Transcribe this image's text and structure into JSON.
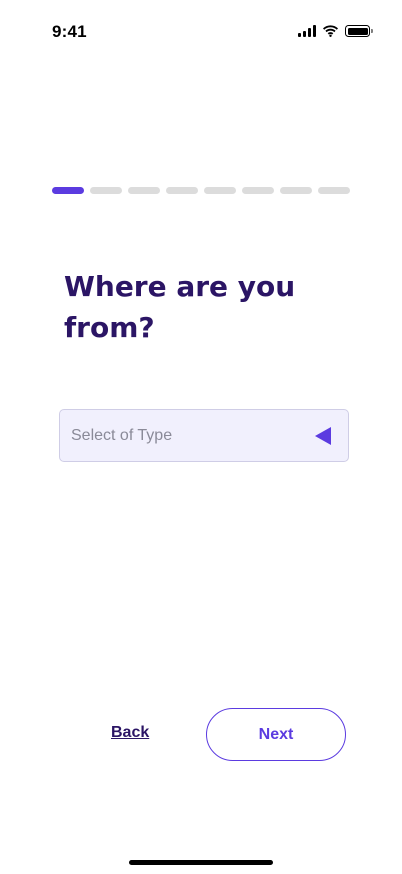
{
  "status_bar": {
    "time": "9:41"
  },
  "progress": {
    "current_step": 1,
    "total_steps": 8
  },
  "question": {
    "title": "Where are you from?"
  },
  "type_select": {
    "placeholder": "Select of Type",
    "arrow_icon": "triangle-left-icon"
  },
  "navigation": {
    "back_label": "Back",
    "next_label": "Next"
  },
  "colors": {
    "accent": "#5b3be0",
    "title": "#2b1565",
    "inactive_step": "#dcdcdc",
    "select_bg": "#f1f0fd"
  }
}
